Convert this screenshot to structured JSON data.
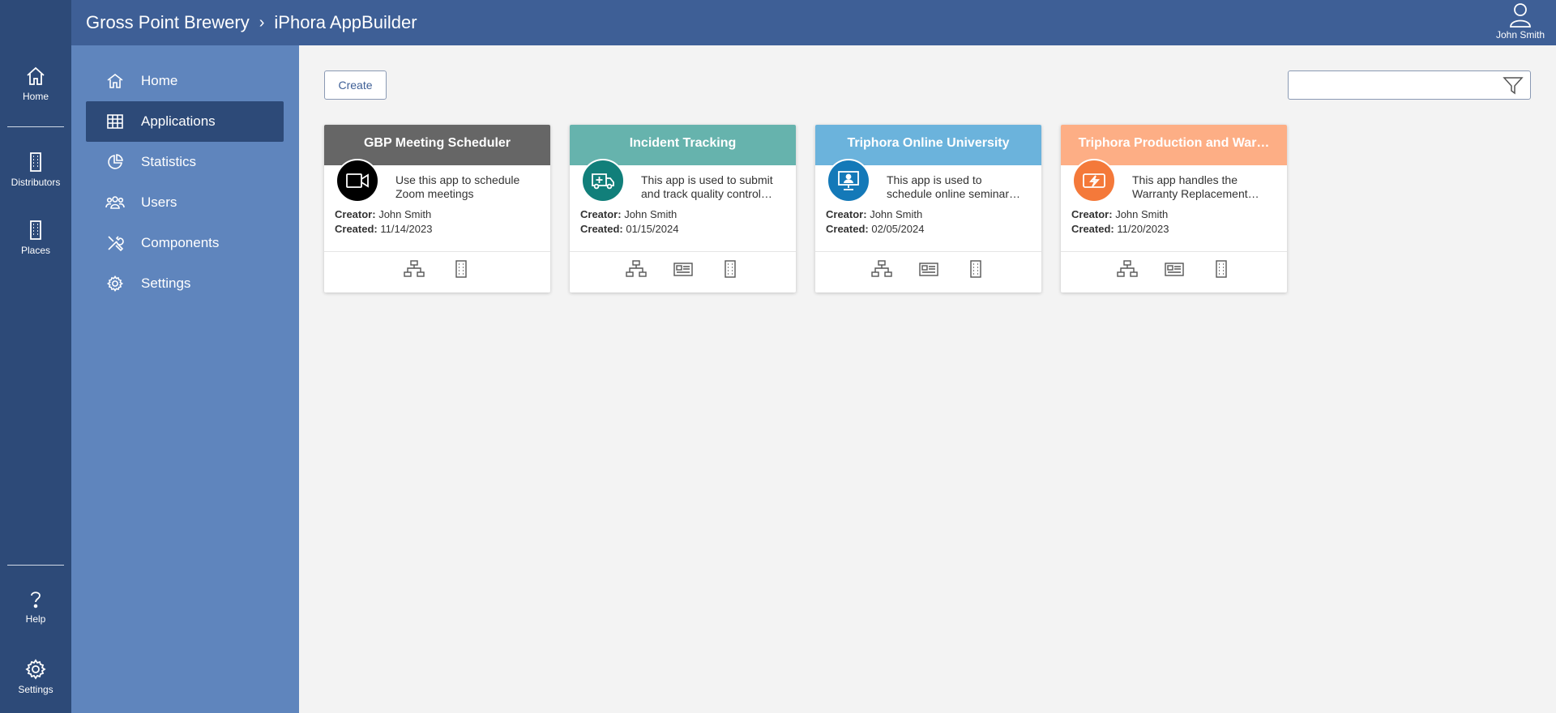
{
  "rail": {
    "items": [
      {
        "label": "Home",
        "icon": "home-icon"
      },
      {
        "label": "Distributors",
        "icon": "building-icon"
      },
      {
        "label": "Places",
        "icon": "building-icon"
      },
      {
        "label": "Help",
        "icon": "help-icon"
      },
      {
        "label": "Settings",
        "icon": "gear-icon"
      }
    ]
  },
  "header": {
    "breadcrumb": [
      "Gross Point Brewery",
      "iPhora AppBuilder"
    ],
    "separator": "›",
    "user_name": "John Smith"
  },
  "sidenav": {
    "items": [
      {
        "label": "Home",
        "icon": "home-icon",
        "active": false
      },
      {
        "label": "Applications",
        "icon": "grid-icon",
        "active": true
      },
      {
        "label": "Statistics",
        "icon": "pie-chart-icon",
        "active": false
      },
      {
        "label": "Users",
        "icon": "users-icon",
        "active": false
      },
      {
        "label": "Components",
        "icon": "tools-icon",
        "active": false
      },
      {
        "label": "Settings",
        "icon": "gear-icon",
        "active": false
      }
    ]
  },
  "main": {
    "create_label": "Create",
    "search_placeholder": "",
    "search_value": ""
  },
  "cards": [
    {
      "title": "GBP Meeting Scheduler",
      "header_color": "#666666",
      "avatar_color": "#000000",
      "icon": "video-camera-icon",
      "desc_line1": "Use this app to schedule",
      "desc_line2": "Zoom meetings",
      "creator_label": "Creator:",
      "creator": "John Smith",
      "created_label": "Created:",
      "created": "11/14/2023",
      "actions": [
        "network-icon",
        "building-icon"
      ]
    },
    {
      "title": "Incident Tracking",
      "header_color": "#66b3ad",
      "avatar_color": "#117f7a",
      "icon": "ambulance-icon",
      "desc_line1": "This app is used to submit",
      "desc_line2": "and track quality control…",
      "creator_label": "Creator:",
      "creator": "John Smith",
      "created_label": "Created:",
      "created": "01/15/2024",
      "actions": [
        "network-icon",
        "newspaper-icon",
        "building-icon"
      ]
    },
    {
      "title": "Triphora Online University",
      "header_color": "#6bb3dc",
      "avatar_color": "#1479b8",
      "icon": "monitor-user-icon",
      "desc_line1": "This app is used to",
      "desc_line2": "schedule online seminar…",
      "creator_label": "Creator:",
      "creator": "John Smith",
      "created_label": "Created:",
      "created": "02/05/2024",
      "actions": [
        "network-icon",
        "newspaper-icon",
        "building-icon"
      ]
    },
    {
      "title": "Triphora Production and War…",
      "header_color": "#fdae85",
      "avatar_color": "#f4793a",
      "icon": "lightning-icon",
      "desc_line1": "This app handles the",
      "desc_line2": "Warranty Replacement…",
      "creator_label": "Creator:",
      "creator": "John Smith",
      "created_label": "Created:",
      "created": "11/20/2023",
      "actions": [
        "network-icon",
        "newspaper-icon",
        "building-icon"
      ]
    }
  ]
}
